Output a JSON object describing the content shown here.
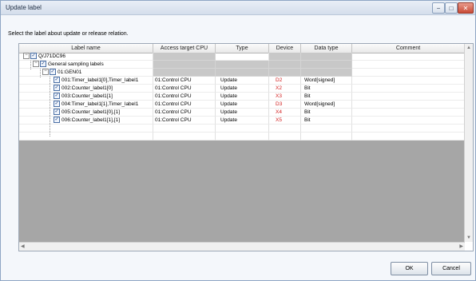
{
  "window": {
    "title": "Update label"
  },
  "window_controls": [
    "−",
    "□",
    "✕"
  ],
  "instruction": "Select the label about update or release relation.",
  "columns": [
    "Label name",
    "Access target CPU",
    "Type",
    "Device",
    "Data type",
    "Comment"
  ],
  "tree": {
    "root": "Q/J71DC96",
    "group": "General sampling labels",
    "subgroup": "01:GEN01"
  },
  "rows": [
    {
      "name": "001:Timer_label1[0],Timer_label1",
      "cpu": "01:Control CPU",
      "type": "Update",
      "device": "D2",
      "datatype": "Word[signed]",
      "comment": ""
    },
    {
      "name": "002:Counter_label1[0]",
      "cpu": "01:Control CPU",
      "type": "Update",
      "device": "X2",
      "datatype": "Bit",
      "comment": ""
    },
    {
      "name": "003:Counter_label1[1]",
      "cpu": "01:Control CPU",
      "type": "Update",
      "device": "X3",
      "datatype": "Bit",
      "comment": ""
    },
    {
      "name": "004:Timer_label1[1],Timer_label1",
      "cpu": "01:Control CPU",
      "type": "Update",
      "device": "D3",
      "datatype": "Word[signed]",
      "comment": ""
    },
    {
      "name": "005:Counter_label1[0],[1]",
      "cpu": "01:Control CPU",
      "type": "Update",
      "device": "X4",
      "datatype": "Bit",
      "comment": ""
    },
    {
      "name": "006:Counter_label1[1],[1]",
      "cpu": "01:Control CPU",
      "type": "Update",
      "device": "X5",
      "datatype": "Bit",
      "comment": ""
    }
  ],
  "buttons": {
    "ok": "OK",
    "cancel": "Cancel"
  },
  "colors": {
    "device_text": "#d21e1e",
    "empty_area": "#a6a6a6",
    "disabled_cell": "#c8c8c8"
  }
}
